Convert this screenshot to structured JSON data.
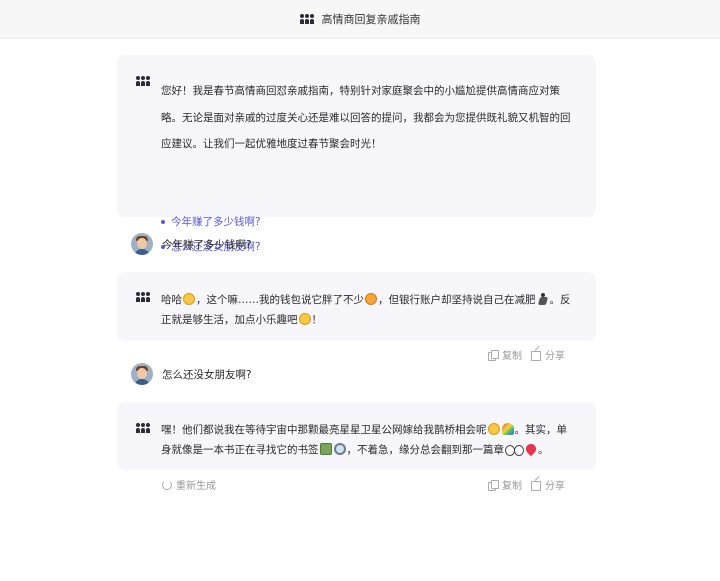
{
  "header": {
    "title": "高情商回复亲戚指南",
    "icon": "people-icon"
  },
  "intro": {
    "text": "您好！我是春节高情商回怼亲戚指南，特别针对家庭聚会中的小尴尬提供高情商应对策略。无论是面对亲戚的过度关心还是难以回答的提问，我都会为您提供既礼貌又机智的回应建议。让我们一起优雅地度过春节聚会时光！",
    "suggestions": [
      "今年赚了多少钱啊?",
      "怎么还没女朋友啊?"
    ]
  },
  "messages": [
    {
      "role": "user",
      "text": "今年赚了多少钱啊?"
    },
    {
      "role": "bot",
      "parts": [
        "哈哈",
        "，这个嘛……我的钱包说它胖了不少",
        "，但银行账户却坚持说自己在减肥",
        "。反正就是够生活，加点小乐趣吧",
        "！"
      ]
    },
    {
      "role": "user",
      "text": "怎么还没女朋友啊?"
    },
    {
      "role": "bot",
      "parts": [
        "嘿！他们都说我在等待宇宙中那颗最亮星星卫星公网嫁给我鹊桥相会呢",
        "。其实，单身就像是一本书正在寻找它的书签",
        "，不着急，缘分总会翻到那一篇章",
        "。"
      ]
    }
  ],
  "actions": {
    "copy": "复制",
    "share": "分享",
    "regenerate": "重新生成"
  },
  "emojis": {
    "smile": "smile-emoji",
    "heart_eyes": "heart-eyes-emoji",
    "runner": "runner-emoji",
    "wink": "wink-emoji",
    "rainbow": "rainbow-emoji",
    "book": "book-emoji",
    "magnifier": "magnifier-emoji",
    "eyes": "eyes-emoji",
    "heart": "heart-emoji"
  },
  "colors": {
    "accent": "#5a5ad0",
    "card_bg": "#f6f6fb",
    "header_bg": "#f7f7f8"
  }
}
